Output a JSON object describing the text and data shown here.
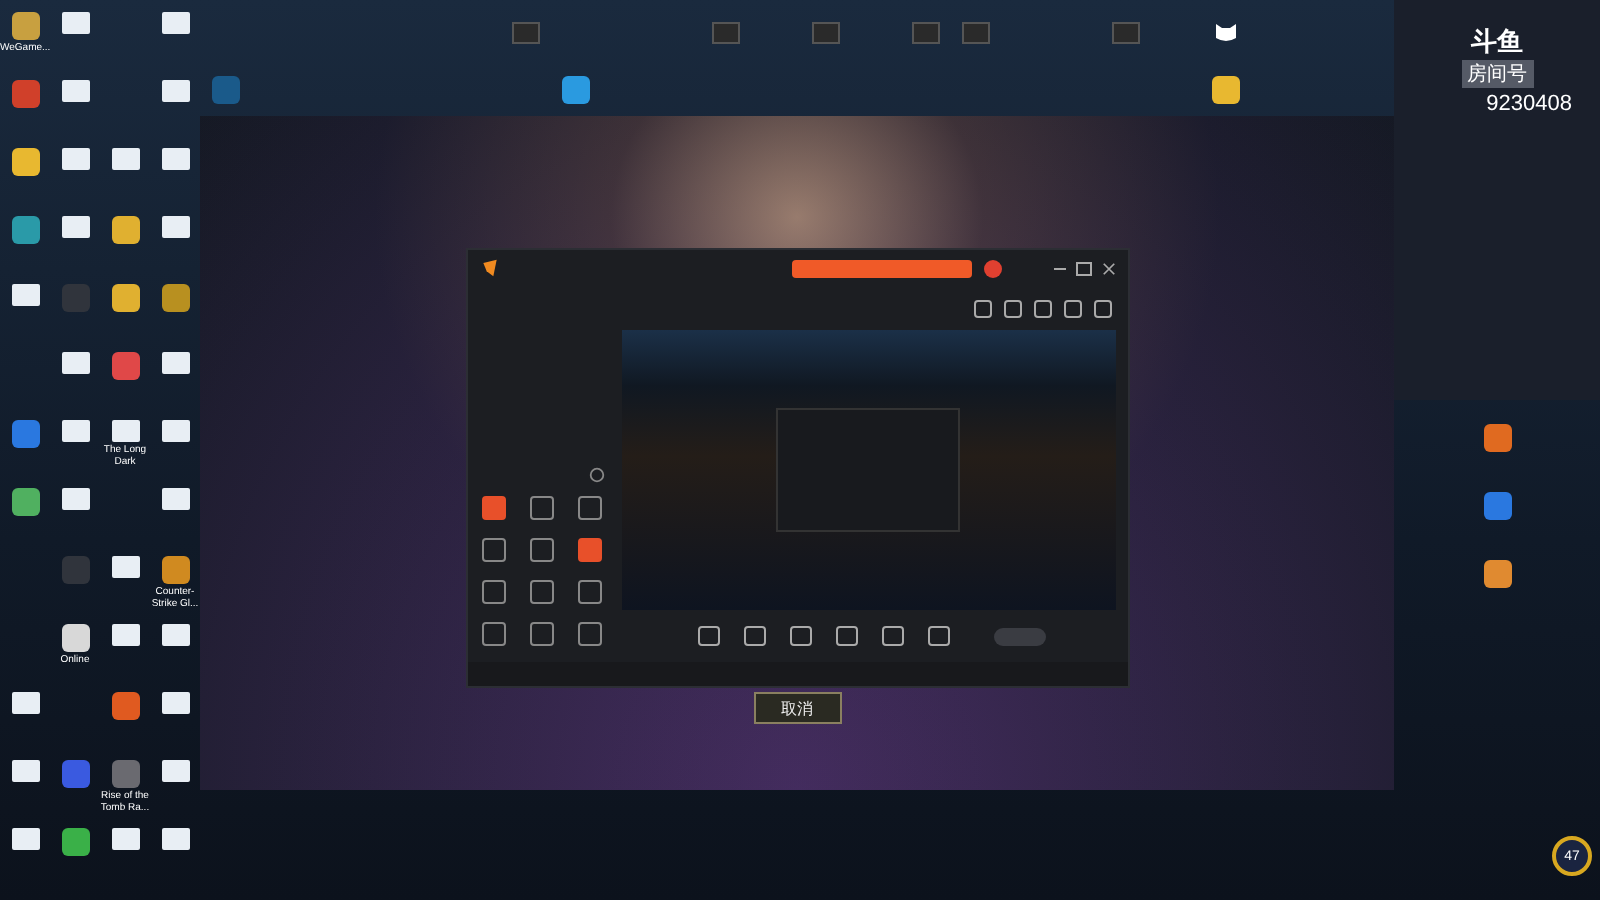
{
  "desktop": {
    "left_icons": [
      [
        {
          "kind": "app",
          "color": "#c8a040",
          "label": "WeGame..."
        },
        {
          "kind": "file"
        },
        {
          "kind": "empty"
        },
        {
          "kind": "file"
        }
      ],
      [
        {
          "kind": "app",
          "color": "#d0402a"
        },
        {
          "kind": "file"
        },
        {
          "kind": "empty"
        },
        {
          "kind": "file"
        }
      ],
      [
        {
          "kind": "app",
          "color": "#e8b830"
        },
        {
          "kind": "file"
        },
        {
          "kind": "file"
        },
        {
          "kind": "file"
        }
      ],
      [
        {
          "kind": "app",
          "color": "#2a9aa8"
        },
        {
          "kind": "file"
        },
        {
          "kind": "app",
          "color": "#e0b030"
        },
        {
          "kind": "file"
        }
      ],
      [
        {
          "kind": "file"
        },
        {
          "kind": "app",
          "color": "#30343c"
        },
        {
          "kind": "app",
          "color": "#e0b030"
        },
        {
          "kind": "app",
          "color": "#b89020"
        }
      ],
      [
        {
          "kind": "empty"
        },
        {
          "kind": "file"
        },
        {
          "kind": "app",
          "color": "#e04848"
        },
        {
          "kind": "file"
        }
      ],
      [
        {
          "kind": "app",
          "color": "#2a78e0"
        },
        {
          "kind": "file"
        },
        {
          "kind": "file",
          "label": "The Long Dark"
        },
        {
          "kind": "file"
        }
      ],
      [
        {
          "kind": "app",
          "color": "#50b060"
        },
        {
          "kind": "file"
        },
        {
          "kind": "empty"
        },
        {
          "kind": "file"
        }
      ],
      [
        {
          "kind": "empty"
        },
        {
          "kind": "app",
          "color": "#30343c"
        },
        {
          "kind": "file"
        },
        {
          "kind": "app",
          "color": "#d08a20",
          "label": "Counter-Strike Gl..."
        }
      ],
      [
        {
          "kind": "empty"
        },
        {
          "kind": "app",
          "color": "#d8d8d8",
          "label": "Online"
        },
        {
          "kind": "file"
        },
        {
          "kind": "file"
        }
      ],
      [
        {
          "kind": "file"
        },
        {
          "kind": "empty"
        },
        {
          "kind": "app",
          "color": "#e05a20"
        },
        {
          "kind": "file"
        }
      ],
      [
        {
          "kind": "file"
        },
        {
          "kind": "app",
          "color": "#3a5ae0"
        },
        {
          "kind": "app",
          "color": "#6a6a70",
          "label": "Rise of the Tomb Ra..."
        },
        {
          "kind": "file"
        }
      ],
      [
        {
          "kind": "file"
        },
        {
          "kind": "app",
          "color": "#3ab048"
        },
        {
          "kind": "file"
        },
        {
          "kind": "file"
        }
      ]
    ],
    "top_icons": [
      [
        {
          "kind": "empty"
        },
        {
          "kind": "empty"
        },
        {
          "kind": "empty"
        },
        {
          "kind": "empty"
        },
        {
          "kind": "empty"
        },
        {
          "kind": "empty"
        },
        {
          "kind": "video"
        },
        {
          "kind": "empty"
        },
        {
          "kind": "empty"
        },
        {
          "kind": "empty"
        },
        {
          "kind": "video"
        },
        {
          "kind": "empty"
        },
        {
          "kind": "video"
        },
        {
          "kind": "empty"
        },
        {
          "kind": "video"
        },
        {
          "kind": "video"
        },
        {
          "kind": "empty"
        },
        {
          "kind": "empty"
        },
        {
          "kind": "video"
        },
        {
          "kind": "empty"
        },
        {
          "kind": "cat"
        }
      ],
      [
        {
          "kind": "app",
          "color": "#1a5a8a"
        },
        {
          "kind": "empty"
        },
        {
          "kind": "empty"
        },
        {
          "kind": "empty"
        },
        {
          "kind": "empty"
        },
        {
          "kind": "empty"
        },
        {
          "kind": "empty"
        },
        {
          "kind": "app",
          "color": "#2a9ae0"
        },
        {
          "kind": "empty"
        },
        {
          "kind": "empty"
        },
        {
          "kind": "empty"
        },
        {
          "kind": "empty"
        },
        {
          "kind": "empty"
        },
        {
          "kind": "empty"
        },
        {
          "kind": "empty"
        },
        {
          "kind": "empty"
        },
        {
          "kind": "empty"
        },
        {
          "kind": "empty"
        },
        {
          "kind": "empty"
        },
        {
          "kind": "empty"
        },
        {
          "kind": "app",
          "color": "#e8b830"
        }
      ]
    ],
    "right_icons": [
      {
        "kind": "app",
        "color": "#e06a20"
      },
      {
        "kind": "app",
        "color": "#2a78e0"
      },
      {
        "kind": "app",
        "color": "#e08a30"
      }
    ]
  },
  "stream_app": {
    "tools": [
      {
        "highlighted": true
      },
      {
        "highlighted": false
      },
      {
        "highlighted": false
      },
      {
        "highlighted": false
      },
      {
        "highlighted": false
      },
      {
        "highlighted": true
      },
      {
        "highlighted": false
      },
      {
        "highlighted": false
      },
      {
        "highlighted": false
      },
      {
        "highlighted": false
      },
      {
        "highlighted": false
      },
      {
        "highlighted": false
      }
    ]
  },
  "cancel_button": "取消",
  "chat_panel": {
    "logo": "斗鱼",
    "room_label": "房间号",
    "room_number": "9230408"
  },
  "battery_badge": "47"
}
